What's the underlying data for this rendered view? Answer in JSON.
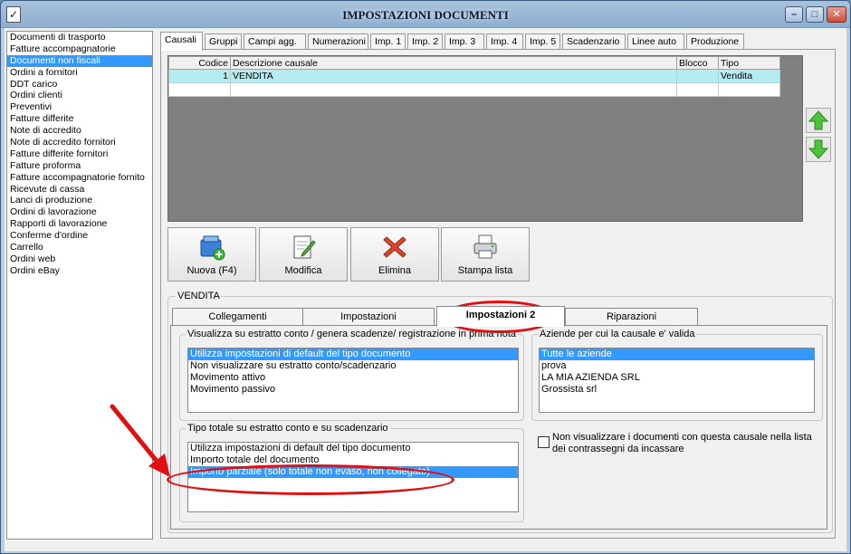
{
  "window": {
    "title": "IMPOSTAZIONI DOCUMENTI",
    "app_icon": "document-check-icon",
    "buttons": {
      "minimize": "–",
      "maximize": "□",
      "close": "✕"
    }
  },
  "doc_types": [
    "Documenti di trasporto",
    "Fatture accompagnatorie",
    "Documenti non fiscali",
    "Ordini a fornitori",
    "DDT carico",
    "Ordini clienti",
    "Preventivi",
    "Fatture differite",
    "Note di accredito",
    "Note di accredito fornitori",
    "Fatture differite fornitori",
    "Fatture proforma",
    "Fatture accompagnatorie fornito",
    "Ricevute di cassa",
    "Lanci di produzione",
    "Ordini di lavorazione",
    "Rapporti di lavorazione",
    "Conferme d'ordine",
    "Carrello",
    "Ordini web",
    "Ordini eBay"
  ],
  "selected_doc_index": 2,
  "tabs": [
    "Causali",
    "Gruppi",
    "Campi agg.",
    "Numerazioni",
    "Imp. 1",
    "Imp. 2",
    "Imp. 3",
    "Imp. 4",
    "Imp. 5",
    "Scadenzario",
    "Linee auto",
    "Produzione"
  ],
  "grid": {
    "headers": {
      "codice": "Codice",
      "descrizione": "Descrizione causale",
      "blocco": "Blocco",
      "tipo": "Tipo"
    },
    "row": {
      "codice": "1",
      "descrizione": "VENDITA",
      "blocco": "",
      "tipo": "Vendita"
    }
  },
  "actions": {
    "nuova": "Nuova (F4)",
    "modifica": "Modifica",
    "elimina": "Elimina",
    "stampa": "Stampa lista"
  },
  "group_title": "VENDITA",
  "inner_tabs": [
    "Collegamenti",
    "Impostazioni",
    "Impostazioni 2",
    "Riparazioni"
  ],
  "estratto": {
    "legend": "Visualizza su estratto conto / genera scadenze/ registrazione  in prima nota",
    "items": [
      "Utilizza impostazioni di default del tipo documento",
      "Non visualizzare su estratto conto/scadenzario",
      "Movimento attivo",
      "Movimento passivo"
    ]
  },
  "aziende": {
    "legend": "Aziende per cui la causale e' valida",
    "items": [
      "Tutte le aziende",
      "prova",
      "LA MIA AZIENDA SRL",
      "Grossista srl"
    ]
  },
  "tipo_totale": {
    "legend": "Tipo totale su estratto conto e su scadenzario",
    "items": [
      "Utilizza impostazioni di default del tipo documento",
      "Importo totale del documento",
      "Importo parziale (solo totale non evaso, non collegato)"
    ]
  },
  "contrassegni": {
    "line1": "Non visualizzare i documenti con questa causale nella lista",
    "line2": "dei contrassegni da incassare"
  },
  "colors": {
    "selection": "#3399ff",
    "annotation": "#e01010",
    "grid_row": "#b5ecf0"
  }
}
